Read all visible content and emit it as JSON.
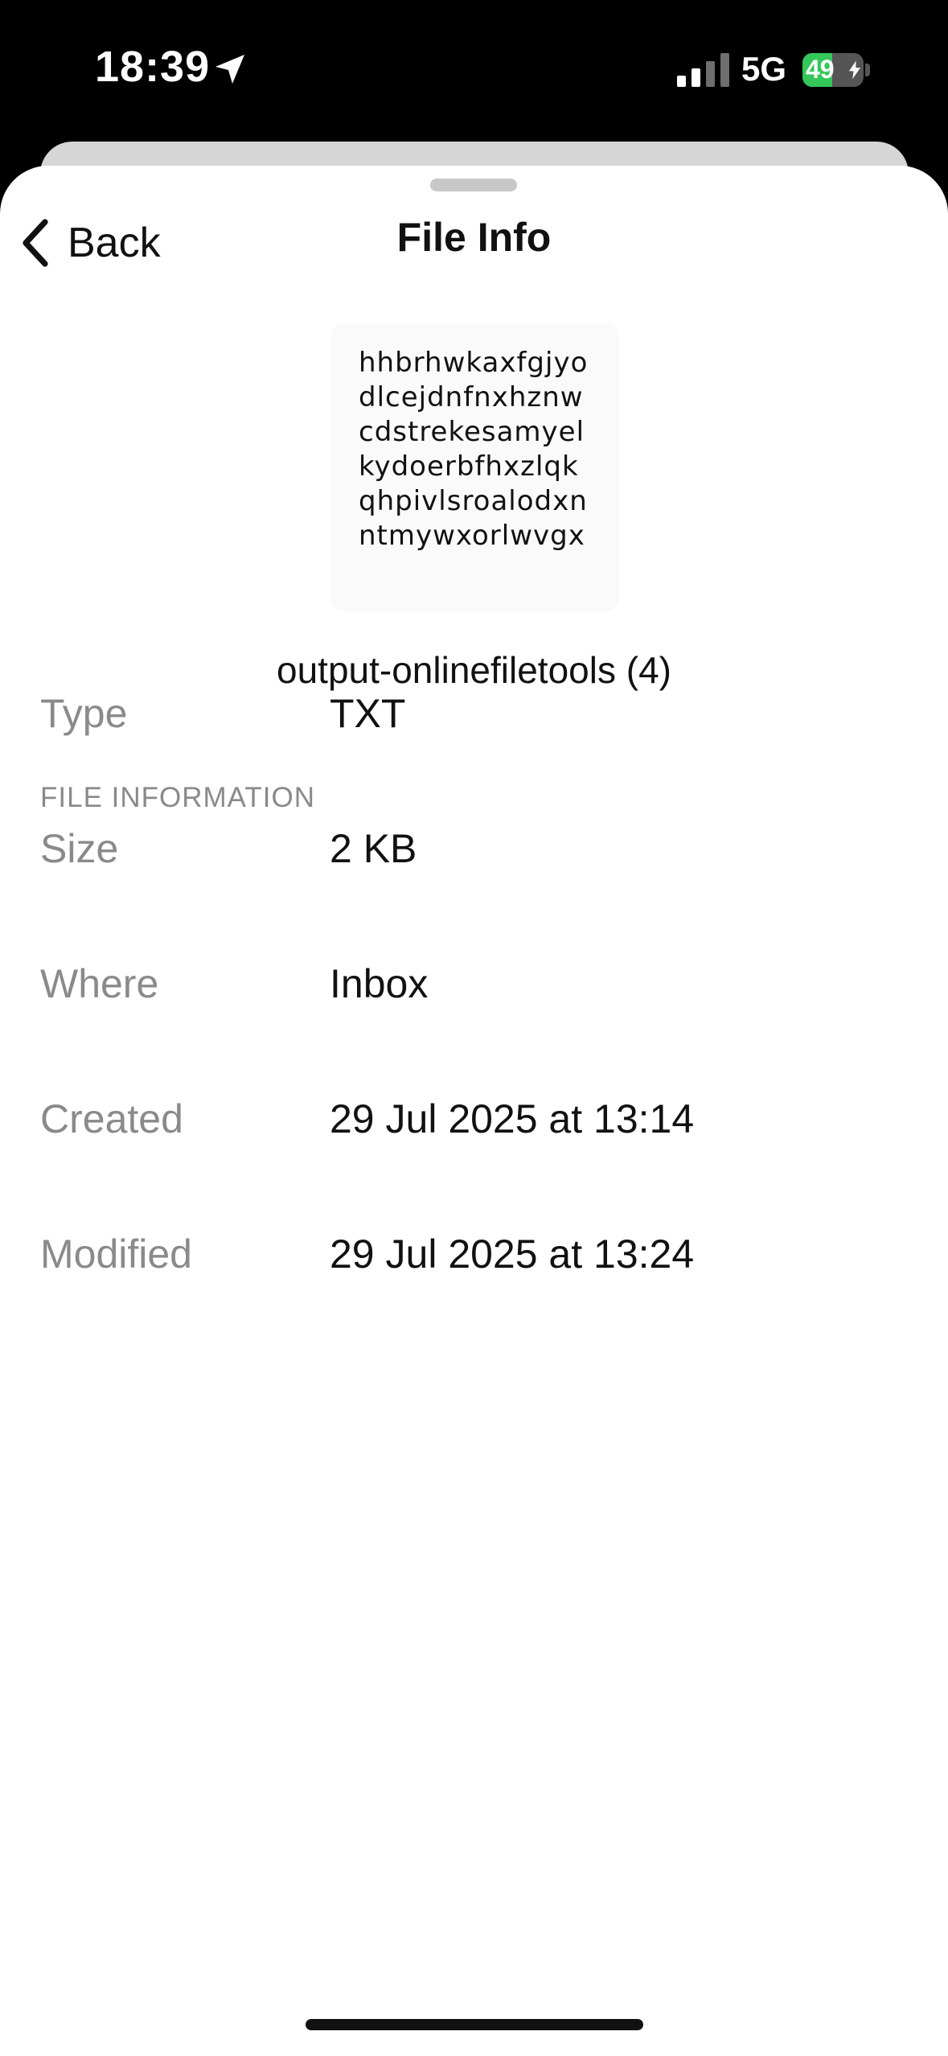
{
  "status_bar": {
    "time": "18:39",
    "network": "5G",
    "battery_level": "49",
    "battery_fraction": 0.49,
    "battery_color": "#34c759",
    "icons": [
      "location-arrow-icon",
      "cellular-signal-icon",
      "battery-charging-icon"
    ]
  },
  "nav": {
    "back_label": "Back",
    "title": "File Info",
    "back_icon": "chevron-left-icon"
  },
  "preview": {
    "lines": [
      "hhbrhwkaxfgjyo",
      "dlcejdnfnxhznw",
      "cdstrekesamyel",
      "kydoerbfhxzlqk",
      "qhpivlsroalodxn",
      "ntmywxorlwvgx"
    ]
  },
  "file_name": "output-onlinefiletools (4)",
  "file_information": {
    "header": "FILE INFORMATION",
    "rows": [
      {
        "label": "Type",
        "value": "TXT"
      },
      {
        "label": "Size",
        "value": "2 KB"
      },
      {
        "label": "Where",
        "value": "Inbox"
      },
      {
        "label": "Created",
        "value": "29 Jul 2025 at 13:14"
      },
      {
        "label": "Modified",
        "value": "29 Jul 2025 at 13:24"
      }
    ]
  }
}
